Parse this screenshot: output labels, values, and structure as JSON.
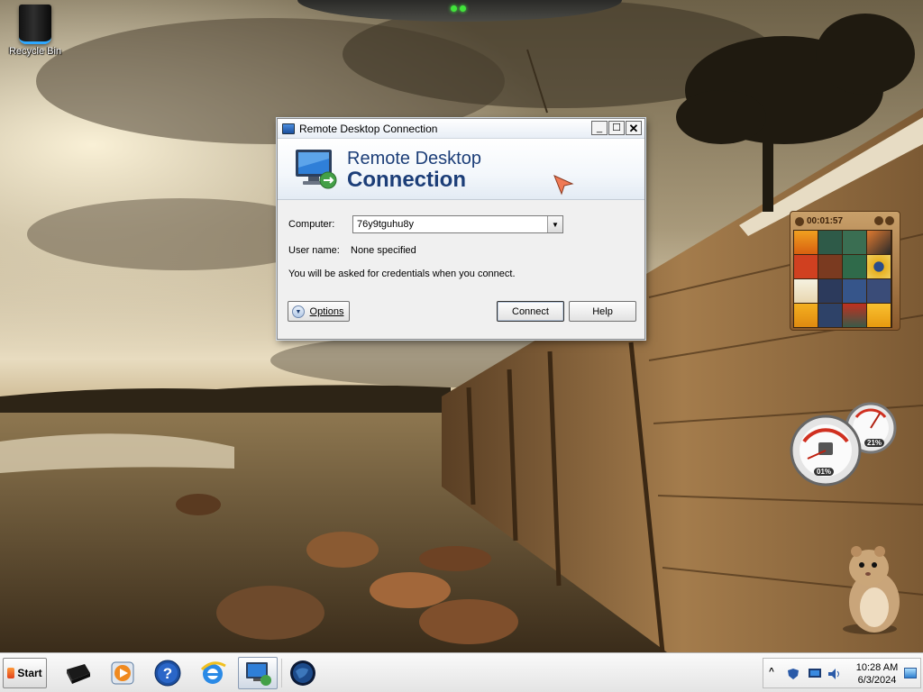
{
  "desktop": {
    "icons": [
      {
        "label": "Recycle Bin",
        "icon": "recycle-bin-icon"
      }
    ]
  },
  "window": {
    "title": "Remote Desktop Connection",
    "buttons": {
      "minimize": "_",
      "maximize": "☐",
      "close": "✕"
    },
    "banner": {
      "line1": "Remote Desktop",
      "line2": "Connection"
    },
    "computer_label": "Computer:",
    "computer_value": "76y9tguhu8y",
    "username_label": "User name:",
    "username_value": "None specified",
    "credentials_note": "You will be asked for credentials when you connect.",
    "options_label": "Options",
    "connect_label": "Connect",
    "help_label": "Help"
  },
  "gadgets": {
    "puzzle_timer": "00:01:57",
    "meter_cpu": "01%",
    "meter_memory": "21%"
  },
  "taskbar": {
    "start_label": "Start",
    "apps": [
      {
        "name": "media-center-icon"
      },
      {
        "name": "media-player-icon"
      },
      {
        "name": "help-icon"
      },
      {
        "name": "internet-explorer-icon"
      },
      {
        "name": "remote-desktop-icon",
        "active": true
      },
      {
        "name": "globe-icon"
      }
    ],
    "tray": {
      "time": "10:28 AM",
      "date": "6/3/2024"
    }
  },
  "colors": {
    "banner_text": "#1c3e78",
    "taskbar_bg": "#e4e4e4",
    "window_bg": "#f0f0f0"
  }
}
